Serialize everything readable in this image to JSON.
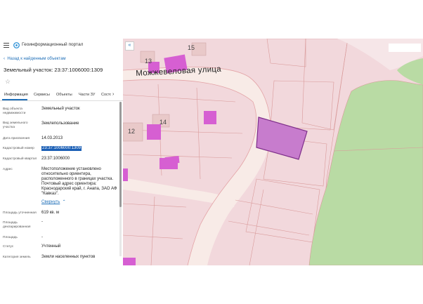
{
  "header": {
    "app_title": "Геоинформационный портал"
  },
  "nav": {
    "back_label": "Назад к найденным объектам"
  },
  "object": {
    "title": "Земельный участок: 23:37:1006000:1309"
  },
  "tabs": [
    "Информация",
    "Сервисы",
    "Объекты",
    "Части ЗУ",
    "Состо"
  ],
  "fields": [
    {
      "label": "Вид объекта недвижимости",
      "value": "Земельный участок"
    },
    {
      "label": "Вид земельного участка",
      "value": "Землепользование"
    },
    {
      "label": "Дата присвоения",
      "value": "14.03.2013"
    },
    {
      "label": "Кадастровый номер",
      "value": "23:37:1006000:1309"
    },
    {
      "label": "Кадастровый квартал",
      "value": "23:37:1006000"
    },
    {
      "label": "Адрес",
      "value": "Местоположение установлено относительно ориентира, расположенного в границах участка. Почтовый адрес ориентира: Краснодарский край, г. Анапа, ЗАО АФ \"Кавказ\"."
    },
    {
      "label": "Площадь уточненная",
      "value": "619 кв. м"
    },
    {
      "label": "Площадь декларированная",
      "value": "-"
    },
    {
      "label": "Площадь",
      "value": "-"
    },
    {
      "label": "Статус",
      "value": "Учтенный"
    },
    {
      "label": "Категория земель",
      "value": "Земли населенных пунктов"
    }
  ],
  "address_toggle": "Свернуть",
  "map": {
    "street_name": "Можжевеловая улица",
    "plot_numbers": [
      "13",
      "15",
      "12",
      "14"
    ],
    "colors": {
      "parcel_fill": "#f3dadd",
      "parcel_line": "#d98a8a",
      "road": "#fbf0ec",
      "building": "#d35bd0",
      "selected": "#c070c8",
      "greenery": "#b8dba0"
    }
  },
  "icons": [
    "menu-icon",
    "portal-logo-icon",
    "back-arrow-icon",
    "star-icon",
    "tabs-next-icon",
    "collapse-panel-icon",
    "chevron-up-icon"
  ]
}
